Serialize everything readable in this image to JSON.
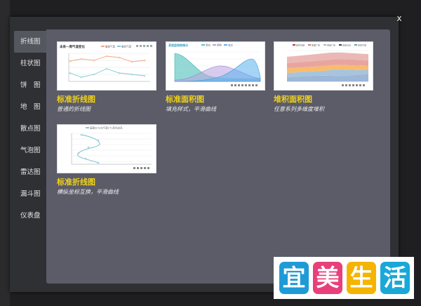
{
  "dialog": {
    "close_label": "x"
  },
  "sidebar": {
    "items": [
      {
        "label": "折线图",
        "active": true
      },
      {
        "label": "柱状图"
      },
      {
        "label": "饼　图"
      },
      {
        "label": "地　图"
      },
      {
        "label": "散点图"
      },
      {
        "label": "气泡图"
      },
      {
        "label": "雷达图"
      },
      {
        "label": "漏斗图"
      },
      {
        "label": "仪表盘"
      }
    ]
  },
  "gallery": {
    "cards": [
      {
        "title": "标准折线图",
        "desc": "普通的折线图",
        "thumb_title": "未来一周气温变化",
        "thumb_legend": [
          "最高气温",
          "最低气温"
        ]
      },
      {
        "title": "标准面积图",
        "desc": "填充样式，平滑曲线",
        "thumb_title": "某楼盘销售情况",
        "thumb_legend": [
          "意向",
          "预购",
          "成交"
        ]
      },
      {
        "title": "堆积面积图",
        "desc": "任意系列多维度堆积",
        "thumb_title": "",
        "thumb_legend": [
          "邮件营销",
          "联盟广告",
          "视频广告",
          "直接访问",
          "搜索引擎"
        ]
      },
      {
        "title": "标准折线图",
        "desc": "横纵坐标互换，平滑曲线",
        "thumb_title": "高度(km)与气温(°C)变化关系",
        "thumb_legend": []
      }
    ]
  },
  "watermark": {
    "chars": [
      "宜",
      "美",
      "生",
      "活"
    ],
    "colors": [
      "#1e9bd7",
      "#e8407a",
      "#f5b400",
      "#19a8d8"
    ],
    "text_color": "#ffffff"
  }
}
